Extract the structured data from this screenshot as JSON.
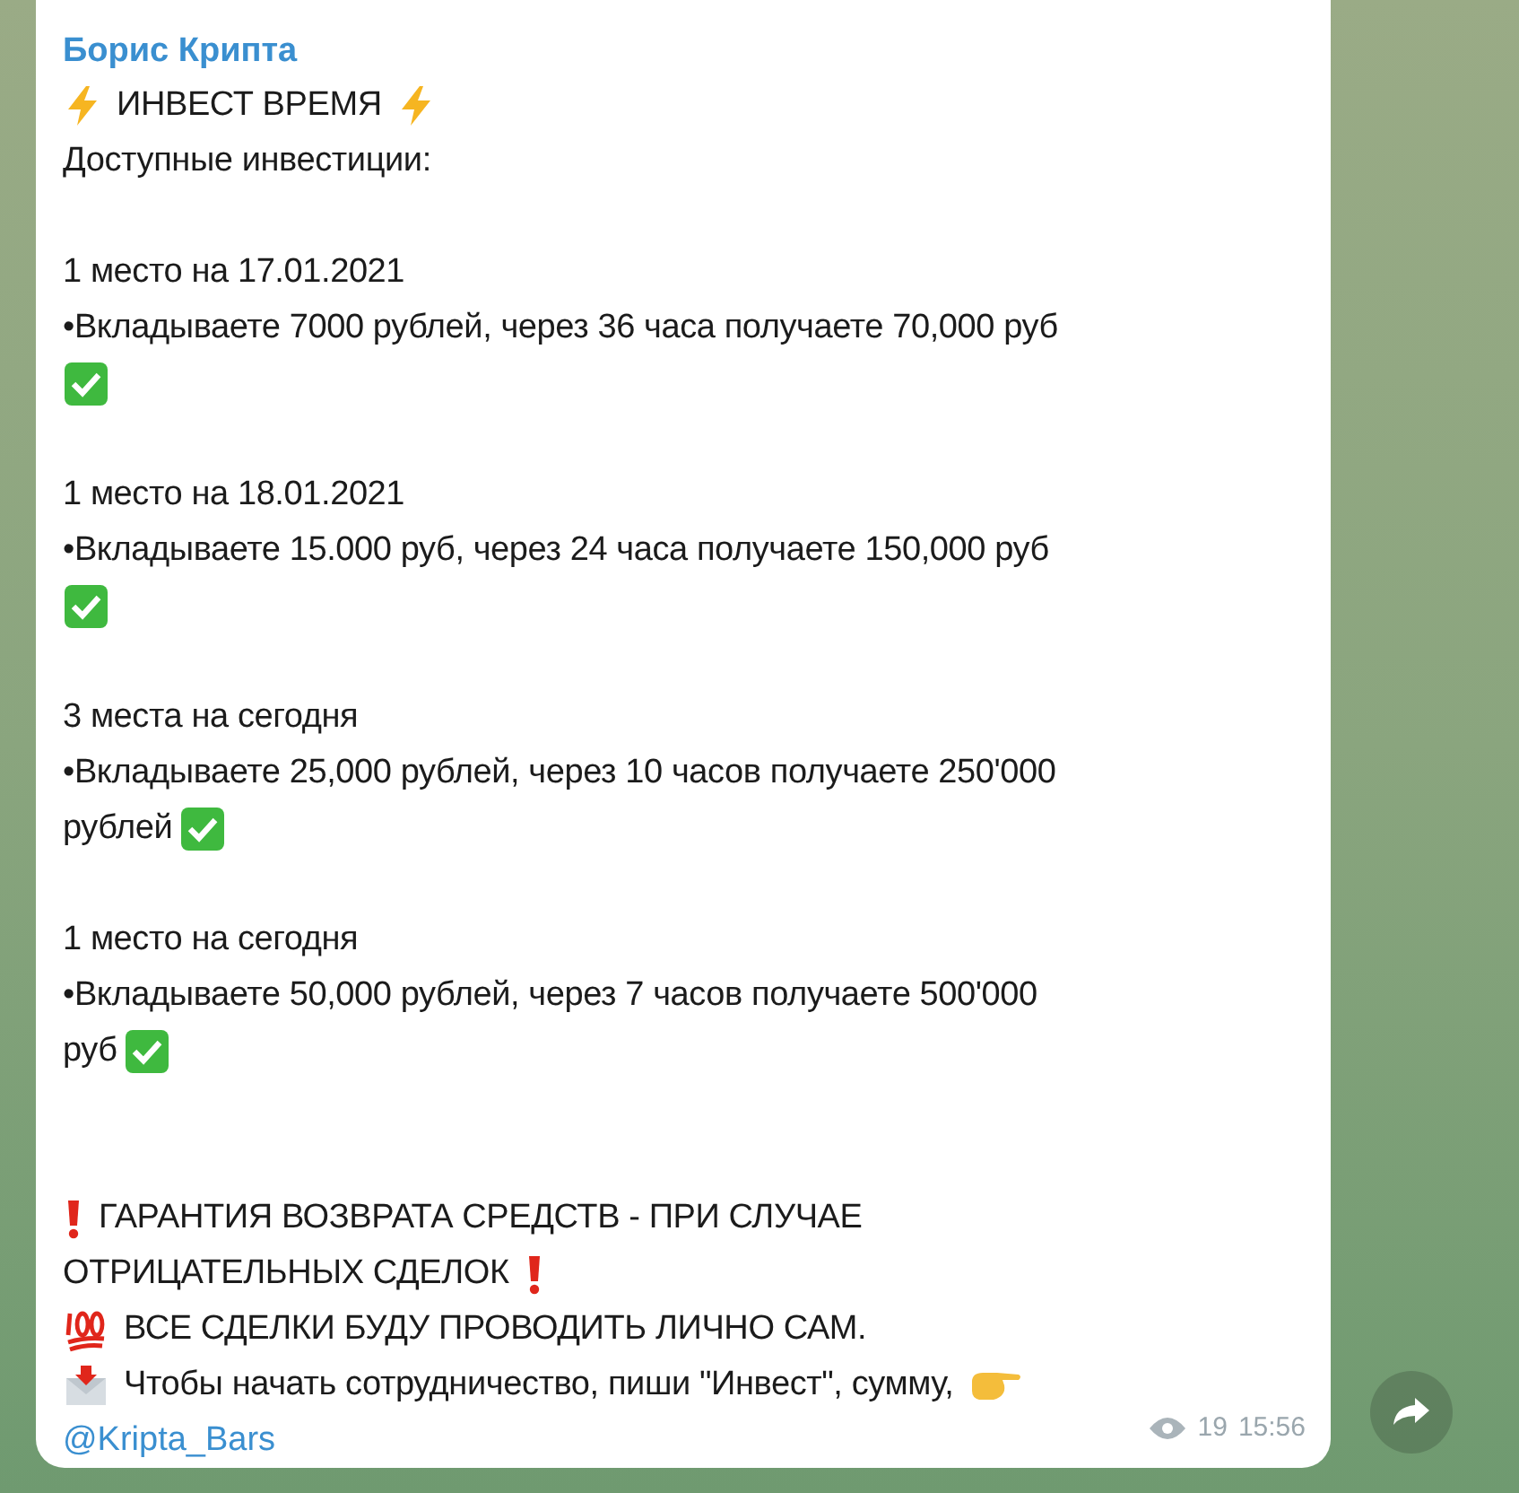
{
  "message": {
    "sender": "Борис Крипта",
    "rows": [
      {
        "kind": "flash",
        "text": "ИНВЕСТ ВРЕМЯ"
      },
      {
        "kind": "plain",
        "text": "Доступные инвестиции:"
      },
      {
        "kind": "blank"
      },
      {
        "kind": "plain",
        "text": "1 место на 17.01.2021"
      },
      {
        "kind": "plain",
        "text": "•Вкладываете 7000 рублей, через 36 часа получаете 70,000 руб"
      },
      {
        "kind": "check"
      },
      {
        "kind": "blank"
      },
      {
        "kind": "plain",
        "text": "1 место на 18.01.2021"
      },
      {
        "kind": "plain",
        "text": "•Вкладываете 15.000 руб, через 24 часа получаете 150,000 руб"
      },
      {
        "kind": "check"
      },
      {
        "kind": "blank"
      },
      {
        "kind": "plain",
        "text": "3  места на сегодня"
      },
      {
        "kind": "plain",
        "text": "•Вкладываете 25,000 рублей, через 10 часов получаете 250'000"
      },
      {
        "kind": "check",
        "text": "рублей"
      },
      {
        "kind": "blank"
      },
      {
        "kind": "plain",
        "text": "1 место на сегодня"
      },
      {
        "kind": "plain",
        "text": "•Вкладываете 50,000 рублей, через 7 часов получаете 500'000"
      },
      {
        "kind": "check",
        "text": "руб"
      },
      {
        "kind": "blank"
      },
      {
        "kind": "blank"
      },
      {
        "kind": "warn-start",
        "text": "ГАРАНТИЯ ВОЗВРАТА СРЕДСТВ - ПРИ СЛУЧАЕ"
      },
      {
        "kind": "warn-end",
        "text": "ОТРИЦАТЕЛЬНЫХ СДЕЛОК"
      },
      {
        "kind": "hundred",
        "text": "ВСЕ СДЕЛКИ БУДУ ПРОВОДИТЬ ЛИЧНО САМ."
      },
      {
        "kind": "mail",
        "text": "Чтобы начать сотрудничество, пиши \"Инвест\", сумму,"
      },
      {
        "kind": "mention",
        "text": "@Kripta_Bars"
      }
    ],
    "views": "19",
    "time": "15:56"
  }
}
